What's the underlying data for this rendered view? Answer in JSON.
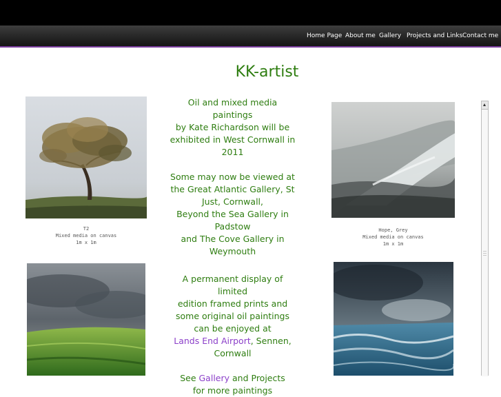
{
  "nav": {
    "items": [
      {
        "label": "Home Page"
      },
      {
        "label": "About me"
      },
      {
        "label": "Gallery"
      },
      {
        "label": "Projects and Links"
      },
      {
        "label": "Contact me"
      }
    ]
  },
  "site_title": "KK-artist",
  "intro": {
    "line1": "Oil and mixed media paintings",
    "line2": "by Kate Richardson will be",
    "line3": "exhibited in West Cornwall in",
    "line4": "2011",
    "view1": "Some may now be viewed at",
    "view2": "the Great Atlantic Gallery, St",
    "view3": "Just, Cornwall,",
    "view4": "Beyond the Sea Gallery in",
    "view5": "Padstow",
    "view6": "and The Cove Gallery in",
    "view7": "Weymouth"
  },
  "prints": {
    "line1": "A permanent display of limited",
    "line2": "edition framed prints and",
    "line3": "some original oil paintings",
    "line4": "can be enjoyed at",
    "airport_link": "Lands End Airport",
    "after_link": ", Sennen,",
    "line6": "Cornwall"
  },
  "see_more": {
    "prefix": "See ",
    "gallery_link": "Gallery",
    "suffix": " and Projects",
    "line2": "for more paintings"
  },
  "paintings": [
    {
      "title": "T2",
      "medium": "Mixed media on canvas",
      "size": "1m x 1m"
    },
    {
      "title": "Hope, Grey",
      "medium": "Mixed media on canvas",
      "size": "1m x 1m"
    }
  ]
}
